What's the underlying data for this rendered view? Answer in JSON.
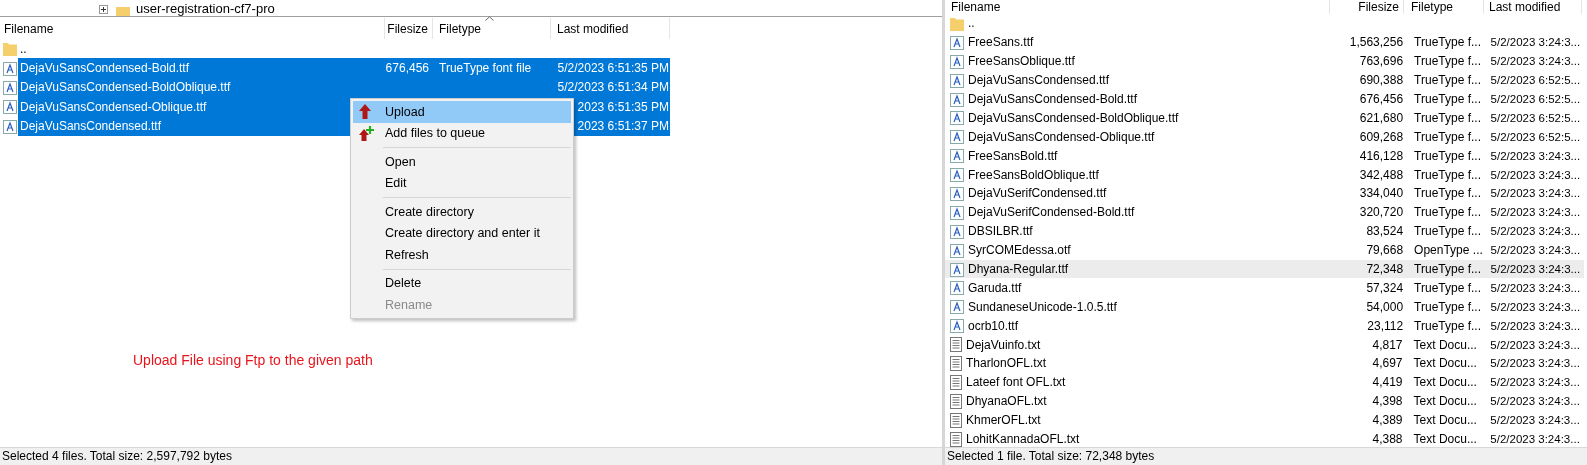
{
  "left_tree": {
    "item": "user-registration-cf7-pro"
  },
  "left_list": {
    "columns": [
      "Filename",
      "Filesize",
      "Filetype",
      "Last modified"
    ],
    "rows": [
      {
        "name": "..",
        "kind": "folder",
        "selected": false
      },
      {
        "name": "DejaVuSansCondensed-Bold.ttf",
        "kind": "font",
        "size": "676,456",
        "type": "TrueType font file",
        "modified": "5/2/2023 6:51:35 PM",
        "selected": true
      },
      {
        "name": "DejaVuSansCondensed-BoldOblique.ttf",
        "kind": "font",
        "modified": "5/2/2023 6:51:34 PM",
        "selected": true
      },
      {
        "name": "DejaVuSansCondensed-Oblique.ttf",
        "kind": "font",
        "modified": "2023 6:51:35 PM",
        "selected": true
      },
      {
        "name": "DejaVuSansCondensed.ttf",
        "kind": "font",
        "modified": "2023 6:51:37 PM",
        "selected": true
      }
    ]
  },
  "context_menu": {
    "groups": [
      [
        {
          "label": "Upload",
          "kind": "upload",
          "selected": true,
          "disabled": false
        },
        {
          "label": "Add files to queue",
          "kind": "queue",
          "selected": false,
          "disabled": false
        }
      ],
      [
        {
          "label": "Open",
          "kind": "plain",
          "selected": false,
          "disabled": false
        },
        {
          "label": "Edit",
          "kind": "plain",
          "selected": false,
          "disabled": false
        }
      ],
      [
        {
          "label": "Create directory",
          "kind": "plain",
          "selected": false,
          "disabled": false
        },
        {
          "label": "Create directory and enter it",
          "kind": "plain",
          "selected": false,
          "disabled": false
        },
        {
          "label": "Refresh",
          "kind": "plain",
          "selected": false,
          "disabled": false
        }
      ],
      [
        {
          "label": "Delete",
          "kind": "plain",
          "selected": false,
          "disabled": false
        },
        {
          "label": "Rename",
          "kind": "plain",
          "selected": false,
          "disabled": true
        }
      ]
    ]
  },
  "annotation": "Upload File using Ftp to the given path",
  "left_status": "Selected 4 files. Total size: 2,597,792 bytes",
  "right_list": {
    "columns": [
      "Filename",
      "Filesize",
      "Filetype",
      "Last modified"
    ],
    "rows": [
      {
        "name": "..",
        "kind": "folder",
        "selected": false
      },
      {
        "name": "FreeSans.ttf",
        "kind": "font",
        "size": "1,563,256",
        "type": "TrueType f...",
        "modified": "5/2/2023 3:24:3...",
        "selected": false
      },
      {
        "name": "FreeSansOblique.ttf",
        "kind": "font",
        "size": "763,696",
        "type": "TrueType f...",
        "modified": "5/2/2023 3:24:3...",
        "selected": false
      },
      {
        "name": "DejaVuSansCondensed.ttf",
        "kind": "font",
        "size": "690,388",
        "type": "TrueType f...",
        "modified": "5/2/2023 6:52:5...",
        "selected": false
      },
      {
        "name": "DejaVuSansCondensed-Bold.ttf",
        "kind": "font",
        "size": "676,456",
        "type": "TrueType f...",
        "modified": "5/2/2023 6:52:5...",
        "selected": false
      },
      {
        "name": "DejaVuSansCondensed-BoldOblique.ttf",
        "kind": "font",
        "size": "621,680",
        "type": "TrueType f...",
        "modified": "5/2/2023 6:52:5...",
        "selected": false
      },
      {
        "name": "DejaVuSansCondensed-Oblique.ttf",
        "kind": "font",
        "size": "609,268",
        "type": "TrueType f...",
        "modified": "5/2/2023 6:52:5...",
        "selected": false
      },
      {
        "name": "FreeSansBold.ttf",
        "kind": "font",
        "size": "416,128",
        "type": "TrueType f...",
        "modified": "5/2/2023 3:24:3...",
        "selected": false
      },
      {
        "name": "FreeSansBoldOblique.ttf",
        "kind": "font",
        "size": "342,488",
        "type": "TrueType f...",
        "modified": "5/2/2023 3:24:3...",
        "selected": false
      },
      {
        "name": "DejaVuSerifCondensed.ttf",
        "kind": "font",
        "size": "334,040",
        "type": "TrueType f...",
        "modified": "5/2/2023 3:24:3...",
        "selected": false
      },
      {
        "name": "DejaVuSerifCondensed-Bold.ttf",
        "kind": "font",
        "size": "320,720",
        "type": "TrueType f...",
        "modified": "5/2/2023 3:24:3...",
        "selected": false
      },
      {
        "name": "DBSILBR.ttf",
        "kind": "font",
        "size": "83,524",
        "type": "TrueType f...",
        "modified": "5/2/2023 3:24:3...",
        "selected": false
      },
      {
        "name": "SyrCOMEdessa.otf",
        "kind": "font",
        "size": "79,668",
        "type": "OpenType ...",
        "modified": "5/2/2023 3:24:3...",
        "selected": false
      },
      {
        "name": "Dhyana-Regular.ttf",
        "kind": "font",
        "size": "72,348",
        "type": "TrueType f...",
        "modified": "5/2/2023 3:24:3...",
        "selected": true
      },
      {
        "name": "Garuda.ttf",
        "kind": "font",
        "size": "57,324",
        "type": "TrueType f...",
        "modified": "5/2/2023 3:24:3...",
        "selected": false
      },
      {
        "name": "SundaneseUnicode-1.0.5.ttf",
        "kind": "font",
        "size": "54,000",
        "type": "TrueType f...",
        "modified": "5/2/2023 3:24:3...",
        "selected": false
      },
      {
        "name": "ocrb10.ttf",
        "kind": "font",
        "size": "23,112",
        "type": "TrueType f...",
        "modified": "5/2/2023 3:24:3...",
        "selected": false
      },
      {
        "name": "DejaVuinfo.txt",
        "kind": "text",
        "size": "4,817",
        "type": "Text Docu...",
        "modified": "5/2/2023 3:24:3...",
        "selected": false
      },
      {
        "name": "TharlonOFL.txt",
        "kind": "text",
        "size": "4,697",
        "type": "Text Docu...",
        "modified": "5/2/2023 3:24:3...",
        "selected": false
      },
      {
        "name": "Lateef font OFL.txt",
        "kind": "text",
        "size": "4,419",
        "type": "Text Docu...",
        "modified": "5/2/2023 3:24:3...",
        "selected": false
      },
      {
        "name": "DhyanaOFL.txt",
        "kind": "text",
        "size": "4,398",
        "type": "Text Docu...",
        "modified": "5/2/2023 3:24:3...",
        "selected": false
      },
      {
        "name": "KhmerOFL.txt",
        "kind": "text",
        "size": "4,389",
        "type": "Text Docu...",
        "modified": "5/2/2023 3:24:3...",
        "selected": false
      },
      {
        "name": "LohitKannadaOFL.txt",
        "kind": "text",
        "size": "4,388",
        "type": "Text Docu...",
        "modified": "5/2/2023 3:24:3...",
        "selected": false
      }
    ]
  },
  "right_status": "Selected 1 file. Total size: 72,348 bytes"
}
